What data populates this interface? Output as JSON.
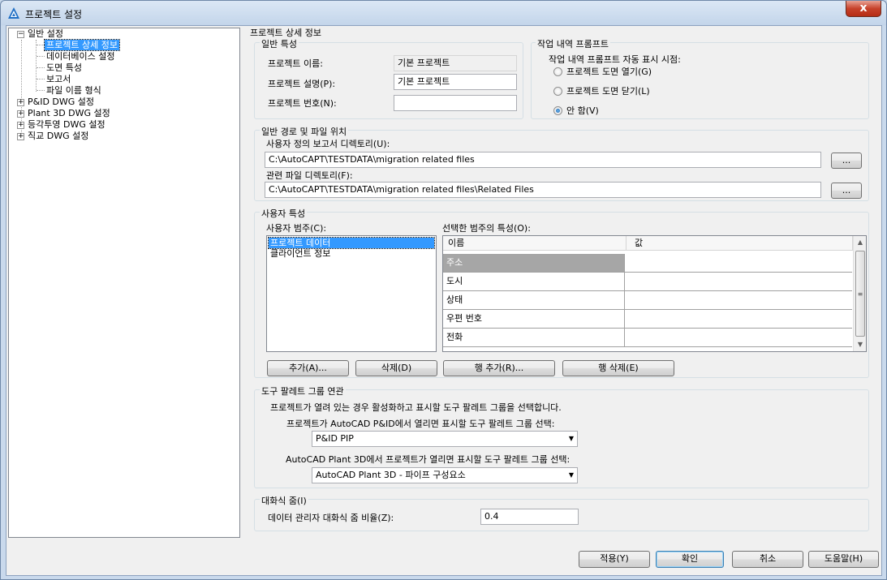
{
  "window": {
    "title": "프로젝트 설정",
    "close_label": "x"
  },
  "tree": {
    "items": [
      {
        "label": "일반 설정",
        "expander": "−"
      },
      {
        "label": "프로젝트 상세 정보"
      },
      {
        "label": "데이터베이스 설정"
      },
      {
        "label": "도면 특성"
      },
      {
        "label": "보고서"
      },
      {
        "label": "파일 이름 형식"
      },
      {
        "label": "P&ID DWG 설정",
        "expander": "+"
      },
      {
        "label": "Plant 3D DWG 설정",
        "expander": "+"
      },
      {
        "label": "등각투영 DWG 설정",
        "expander": "+"
      },
      {
        "label": "직교 DWG 설정",
        "expander": "+"
      }
    ]
  },
  "page_title": "프로젝트 상세 정보",
  "general": {
    "title": "일반 특성",
    "name_label": "프로젝트 이름:",
    "name_value": "기본 프로젝트",
    "desc_label": "프로젝트 설명(P):",
    "desc_value": "기본 프로젝트",
    "number_label": "프로젝트 번호(N):",
    "number_value": ""
  },
  "history": {
    "title": "작업 내역 프롬프트",
    "subtitle": "작업 내역 프롬프트 자동 표시 시점:",
    "options": [
      {
        "label": "프로젝트 도면 열기(G)",
        "checked": false
      },
      {
        "label": "프로젝트 도면 닫기(L)",
        "checked": false
      },
      {
        "label": "안 함(V)",
        "checked": true
      }
    ]
  },
  "paths": {
    "title": "일반 경로 및 파일 위치",
    "report_label": "사용자 정의 보고서 디렉토리(U):",
    "report_value": "C:\\AutoCAPT\\TESTDATA\\migration related files",
    "related_label": "관련 파일 디렉토리(F):",
    "related_value": "C:\\AutoCAPT\\TESTDATA\\migration related files\\Related Files",
    "browse_label": "..."
  },
  "user_props": {
    "title": "사용자 특성",
    "categories_label": "사용자 범주(C):",
    "categories": [
      "프로젝트 데이터",
      "클라이언트 정보"
    ],
    "selected_label": "선택한 범주의 특성(O):",
    "grid_headers": [
      "이름",
      "값"
    ],
    "rows": [
      "주소",
      "도시",
      "상태",
      "우편 번호",
      "전화"
    ],
    "add_btn": "추가(A)...",
    "delete_btn": "삭제(D)",
    "add_row_btn": "행 추가(R)...",
    "delete_row_btn": "행 삭제(E)"
  },
  "palette": {
    "title": "도구 팔레트 그룹 연관",
    "desc": "프로젝트가 열려 있는 경우 활성화하고 표시할 도구 팔레트 그룹을 선택합니다.",
    "pid_label": "프로젝트가 AutoCAD P&ID에서 열리면 표시할 도구 팔레트 그룹 선택:",
    "pid_value": "P&ID PIP",
    "plant_label": "AutoCAD Plant 3D에서 프로젝트가 열리면 표시할 도구 팔레트 그룹 선택:",
    "plant_value": "AutoCAD Plant 3D - 파이프 구성요소"
  },
  "zoom": {
    "title": "대화식 줌(I)",
    "label": "데이터 관리자 대화식 줌 비율(Z):",
    "value": "0.4"
  },
  "footer": {
    "apply": "적용(Y)",
    "ok": "확인",
    "cancel": "취소",
    "help": "도움말(H)"
  }
}
